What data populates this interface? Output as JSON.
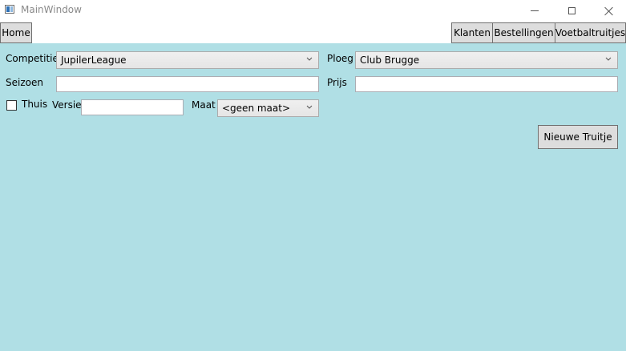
{
  "window": {
    "title": "MainWindow"
  },
  "nav": {
    "home": "Home",
    "klanten": "Klanten",
    "bestellingen": "Bestellingen",
    "voetbaltruitjes": "Voetbaltruitjes"
  },
  "form": {
    "competitie": {
      "label": "Competitie",
      "value": "JupilerLeague"
    },
    "ploeg": {
      "label": "Ploeg",
      "value": "Club Brugge"
    },
    "seizoen": {
      "label": "Seizoen",
      "value": ""
    },
    "prijs": {
      "label": "Prijs",
      "value": ""
    },
    "thuis": {
      "label": "Thuis",
      "checked": false
    },
    "versie": {
      "label": "Versie",
      "value": ""
    },
    "maat": {
      "label": "Maat",
      "value": "<geen maat>"
    }
  },
  "actions": {
    "nieuwe_truitje": "Nieuwe Truitje"
  },
  "colors": {
    "content_background": "#b0dfe5",
    "button_background": "#dddddd"
  },
  "icons": [
    "app-icon",
    "minimize-icon",
    "maximize-icon",
    "close-icon",
    "chevron-down-icon"
  ]
}
